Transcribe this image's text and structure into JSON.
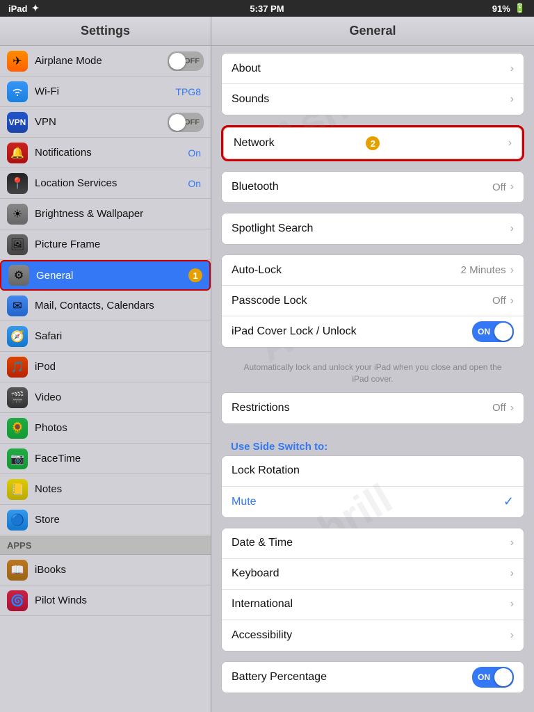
{
  "statusBar": {
    "left": "iPad",
    "signal": "✦",
    "center": "5:37 PM",
    "battery": "91%"
  },
  "sidebar": {
    "title": "Settings",
    "items": [
      {
        "id": "airplane",
        "label": "Airplane Mode",
        "valueType": "toggle",
        "toggleState": "OFF",
        "icon": "✈"
      },
      {
        "id": "wifi",
        "label": "Wi-Fi",
        "value": "TPG8",
        "valueType": "text",
        "icon": "📶"
      },
      {
        "id": "vpn",
        "label": "VPN",
        "valueType": "toggle",
        "toggleState": "OFF",
        "icon": "🔒"
      },
      {
        "id": "notifications",
        "label": "Notifications",
        "value": "On",
        "valueType": "on",
        "icon": "🔴"
      },
      {
        "id": "location",
        "label": "Location Services",
        "value": "On",
        "valueType": "on",
        "icon": "📍"
      },
      {
        "id": "brightness",
        "label": "Brightness & Wallpaper",
        "valueType": "none",
        "icon": "☀"
      },
      {
        "id": "pictureframe",
        "label": "Picture Frame",
        "valueType": "none",
        "icon": "⚙"
      },
      {
        "id": "general",
        "label": "General",
        "badge": "1",
        "valueType": "badge",
        "icon": "⚙",
        "active": true
      }
    ],
    "secondGroup": [
      {
        "id": "mail",
        "label": "Mail, Contacts, Calendars",
        "valueType": "none",
        "icon": "✉"
      },
      {
        "id": "safari",
        "label": "Safari",
        "valueType": "none",
        "icon": "🧭"
      },
      {
        "id": "ipod",
        "label": "iPod",
        "valueType": "none",
        "icon": "🎵"
      },
      {
        "id": "video",
        "label": "Video",
        "valueType": "none",
        "icon": "🎬"
      },
      {
        "id": "photos",
        "label": "Photos",
        "valueType": "none",
        "icon": "🌻"
      },
      {
        "id": "facetime",
        "label": "FaceTime",
        "valueType": "none",
        "icon": "📷"
      },
      {
        "id": "notes",
        "label": "Notes",
        "valueType": "none",
        "icon": "📒"
      },
      {
        "id": "store",
        "label": "Store",
        "valueType": "none",
        "icon": "🔵"
      }
    ],
    "appsSection": "Apps",
    "appsItems": [
      {
        "id": "ibooks",
        "label": "iBooks",
        "valueType": "none",
        "icon": "📖"
      },
      {
        "id": "pilotwinds",
        "label": "Pilot Winds",
        "valueType": "none",
        "icon": "🌀"
      }
    ]
  },
  "rightPanel": {
    "title": "General",
    "groups": [
      {
        "id": "group1",
        "rows": [
          {
            "id": "about",
            "label": "About",
            "value": "",
            "chevron": true
          },
          {
            "id": "sounds",
            "label": "Sounds",
            "value": "",
            "chevron": true
          }
        ]
      },
      {
        "id": "group-network",
        "highlighted": true,
        "rows": [
          {
            "id": "network",
            "label": "Network",
            "badge": "2",
            "value": "",
            "chevron": true
          }
        ]
      },
      {
        "id": "group2",
        "rows": [
          {
            "id": "bluetooth",
            "label": "Bluetooth",
            "value": "Off",
            "chevron": true
          }
        ]
      },
      {
        "id": "group3",
        "rows": [
          {
            "id": "spotlight",
            "label": "Spotlight Search",
            "value": "",
            "chevron": true
          }
        ]
      },
      {
        "id": "group4",
        "rows": [
          {
            "id": "autolock",
            "label": "Auto-Lock",
            "value": "2 Minutes",
            "chevron": true
          },
          {
            "id": "passcode",
            "label": "Passcode Lock",
            "value": "Off",
            "chevron": true
          },
          {
            "id": "ipadcover",
            "label": "iPad Cover Lock / Unlock",
            "value": "ON",
            "valueType": "toggle-on",
            "chevron": false
          }
        ]
      }
    ],
    "ipadCoverSubtitle": "Automatically lock and unlock your iPad when you close and open the iPad cover.",
    "restrictionsGroup": {
      "rows": [
        {
          "id": "restrictions",
          "label": "Restrictions",
          "value": "Off",
          "chevron": true
        }
      ]
    },
    "useSideSwitch": "Use Side Switch to:",
    "sideSwitchGroup": {
      "rows": [
        {
          "id": "lockrotation",
          "label": "Lock Rotation",
          "selected": false
        },
        {
          "id": "mute",
          "label": "Mute",
          "selected": true
        }
      ]
    },
    "bottomGroups": [
      {
        "id": "datetime-group",
        "rows": [
          {
            "id": "datetime",
            "label": "Date & Time",
            "value": "",
            "chevron": true
          },
          {
            "id": "keyboard",
            "label": "Keyboard",
            "value": "",
            "chevron": true
          },
          {
            "id": "international",
            "label": "International",
            "value": "",
            "chevron": true
          },
          {
            "id": "accessibility",
            "label": "Accessibility",
            "value": "",
            "chevron": true
          }
        ]
      },
      {
        "id": "battery-group",
        "rows": [
          {
            "id": "battery",
            "label": "Battery Percentage",
            "value": "ON",
            "valueType": "toggle-on",
            "chevron": false
          }
        ]
      }
    ]
  },
  "watermark": "Ashrill"
}
